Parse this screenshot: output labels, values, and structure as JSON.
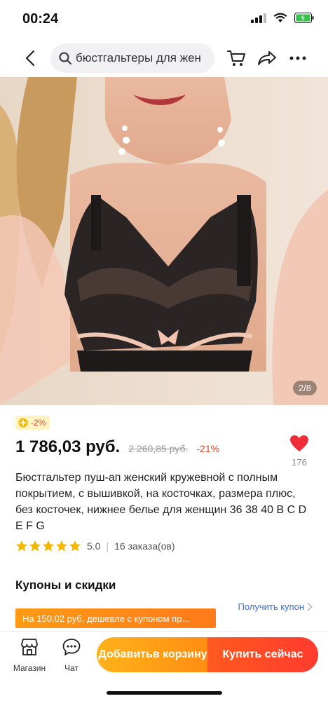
{
  "status": {
    "time": "00:24"
  },
  "nav": {
    "search_text": "бюстгальтеры для жен"
  },
  "image": {
    "counter": "2/8"
  },
  "discount": {
    "badge": "-2%"
  },
  "price": {
    "current": "1 786,03 руб.",
    "old": "2 260,85 руб.",
    "discount_pct": "-21%"
  },
  "wishlist": {
    "count": "176"
  },
  "product": {
    "title": "Бюстгальтер пуш-ап женский кружевной с полным покрытием, с вышивкой, на косточках, размера плюс, без косточек, нижнее белье для женщин 36 38 40 B C D E F G",
    "rating": "5.0",
    "rating_stars": 5,
    "orders": "16 заказа(ов)"
  },
  "coupons": {
    "title": "Купоны и скидки",
    "link": "Получить купон",
    "banner": "На 150,02 руб. дешевле с купоном пр..."
  },
  "bottom": {
    "store_label": "Магазин",
    "chat_label": "Чат",
    "add_to_cart": "Добавить в корзину",
    "buy_now": "Купить сейчас"
  },
  "colors": {
    "price_red": "#e0462a",
    "star": "#f5b800",
    "cart_orange": "#ff9a14",
    "buy_red": "#ff3b2f",
    "link_blue": "#3a6fd8"
  }
}
